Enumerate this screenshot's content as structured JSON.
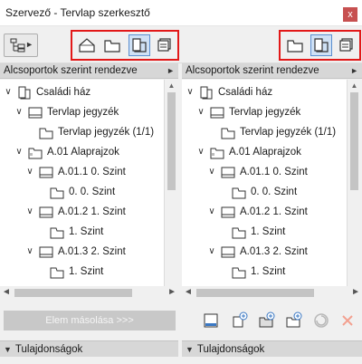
{
  "window": {
    "title": "Szervező - Tervlap szerkesztő",
    "close_glyph": "x"
  },
  "toolbar": {
    "nav_arrow": "►"
  },
  "left_panel": {
    "sort_label": "Alcsoportok szerint rendezve",
    "tree": [
      {
        "label": "Családi ház",
        "level": 0,
        "icon": "book-icon"
      },
      {
        "label": "Tervlap jegyzék",
        "level": 1,
        "icon": "sheet-icon"
      },
      {
        "label": "Tervlap jegyzék (1/1)",
        "level": 2,
        "icon": "page-icon"
      },
      {
        "label": "A.01 Alaprajzok",
        "level": 1,
        "icon": "folder-icon"
      },
      {
        "label": "A.01.1 0. Szint",
        "level": 2,
        "icon": "sheet-icon"
      },
      {
        "label": "0. 0. Szint",
        "level": 3,
        "icon": "page-icon"
      },
      {
        "label": "A.01.2 1. Szint",
        "level": 2,
        "icon": "sheet-icon"
      },
      {
        "label": "1. Szint",
        "level": 3,
        "icon": "page-icon"
      },
      {
        "label": "A.01.3 2. Szint",
        "level": 2,
        "icon": "sheet-icon"
      },
      {
        "label": "1. Szint",
        "level": 3,
        "icon": "page-icon"
      }
    ]
  },
  "right_panel": {
    "sort_label": "Alcsoportok szerint rendezve",
    "tree": [
      {
        "label": "Családi ház",
        "level": 0,
        "icon": "book-icon"
      },
      {
        "label": "Tervlap jegyzék",
        "level": 1,
        "icon": "sheet-icon"
      },
      {
        "label": "Tervlap jegyzék (1/1)",
        "level": 2,
        "icon": "page-icon"
      },
      {
        "label": "A.01 Alaprajzok",
        "level": 1,
        "icon": "folder-icon"
      },
      {
        "label": "A.01.1 0. Szint",
        "level": 2,
        "icon": "sheet-icon"
      },
      {
        "label": "0. 0. Szint",
        "level": 3,
        "icon": "page-icon"
      },
      {
        "label": "A.01.2 1. Szint",
        "level": 2,
        "icon": "sheet-icon"
      },
      {
        "label": "1. Szint",
        "level": 3,
        "icon": "page-icon"
      },
      {
        "label": "A.01.3 2. Szint",
        "level": 2,
        "icon": "sheet-icon"
      },
      {
        "label": "1. Szint",
        "level": 3,
        "icon": "page-icon"
      }
    ]
  },
  "copy_button": {
    "label": "Elem másolása >>>"
  },
  "properties": {
    "left_label": "Tulajdonságok",
    "right_label": "Tulajdonságok"
  },
  "colors": {
    "highlight_frame": "#e21818",
    "active_button": "#cfe1f5",
    "close_button": "#c75050"
  }
}
